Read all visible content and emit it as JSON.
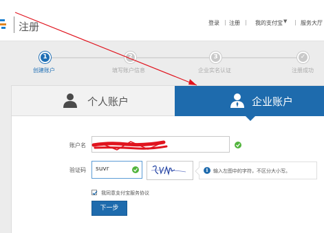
{
  "header": {
    "title": "注册",
    "nav": {
      "login": "登录",
      "sep": "|",
      "register": "注册",
      "my_alipay": "我的支付宝",
      "caret": "▼",
      "service_hall": "服务大厅"
    }
  },
  "steps": [
    {
      "number": "1",
      "label": "创建账户",
      "state": "active"
    },
    {
      "number": "2",
      "label": "填写账户信息",
      "state": "inactive"
    },
    {
      "number": "3",
      "label": "企业实名认证",
      "state": "inactive"
    },
    {
      "number": "✓",
      "label": "注册成功",
      "state": "inactive"
    }
  ],
  "tabs": {
    "personal": "个人账户",
    "business": "企业账户"
  },
  "form": {
    "account_label": "账户名",
    "account_value": "",
    "captcha_label": "验证码",
    "captcha_value": "suvr",
    "captcha_image_text": "SUVR",
    "captcha_tip": "输入左图中的字符，不区分大小写。",
    "agree_prefix": "我同意",
    "agree_link": "支付宝服务协议",
    "agree_checked": true,
    "next_button": "下一步"
  },
  "colors": {
    "accent": "#1e6bad",
    "success": "#52b43d",
    "annotation": "#e0141e"
  }
}
